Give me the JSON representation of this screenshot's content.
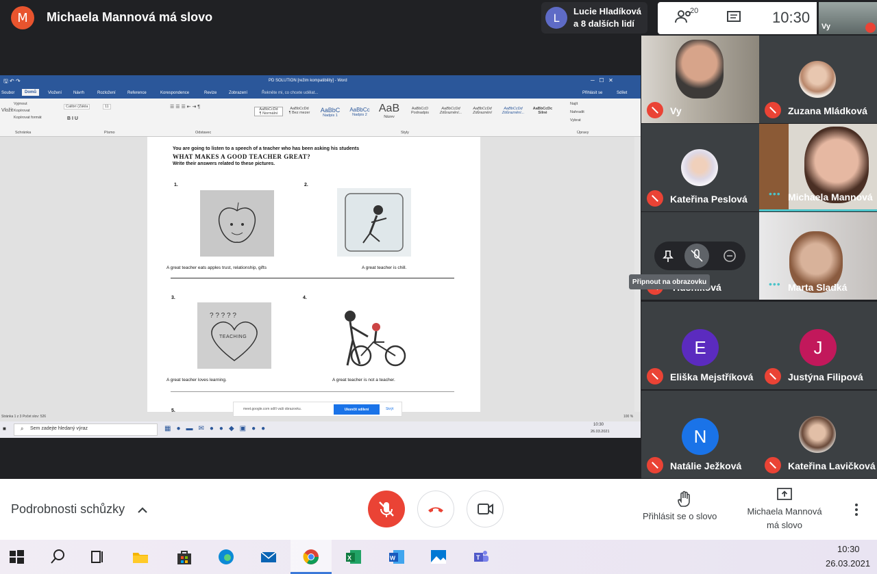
{
  "meeting": {
    "presenter_initial": "M",
    "presenter_title": "Michaela Mannová má slovo",
    "raised_hands_initial": "L",
    "raised_hands_line1": "Lucie Hladíková",
    "raised_hands_line2": "a 8 dalších lidí",
    "people_count": "20",
    "time": "10:30",
    "self_label": "Vy"
  },
  "word": {
    "window_title": "PD SOLUTION [režim kompatibility] - Word",
    "tabs": [
      "Soubor",
      "Domů",
      "Vložení",
      "Návrh",
      "Rozložení",
      "Reference",
      "Korespondence",
      "Revize",
      "Zobrazení"
    ],
    "tell_me": "Řekněte mi, co chcete udělat...",
    "sign_in": "Přihlásit se",
    "share": "Sdílet",
    "clipboard": {
      "cut": "Vyjmout",
      "copy": "Kopírovat",
      "format": "Kopírovat formát",
      "group": "Schránka",
      "paste": "Vložit"
    },
    "font_name": "Calibri (Zákla",
    "font_size": "11",
    "group_font": "Písmo",
    "group_paragraph": "Odstavec",
    "group_styles": "Styly",
    "group_edit": "Úpravy",
    "styles": [
      {
        "sample": "AaBbCcDd",
        "name": "¶ Normální"
      },
      {
        "sample": "AaBbCcDd",
        "name": "¶ Bez mezer"
      },
      {
        "sample": "AaBbC",
        "name": "Nadpis 1"
      },
      {
        "sample": "AaBbCc",
        "name": "Nadpis 2"
      },
      {
        "sample": "AaB",
        "name": "Název"
      },
      {
        "sample": "AaBbCcD",
        "name": "Podnadpis"
      },
      {
        "sample": "AaBbCcDd",
        "name": "Zdůraznění..."
      },
      {
        "sample": "AaBbCcDd",
        "name": "Zdůraznění"
      },
      {
        "sample": "AaBbCcDd",
        "name": "Zdůraznění..."
      },
      {
        "sample": "AaBbCcDc",
        "name": "Silné"
      }
    ],
    "edit": {
      "find": "Najít",
      "replace": "Nahradit",
      "select": "Vybrat"
    },
    "status_left": "Stránka 1 z 3   Počet slov: 526",
    "zoom": "100 %",
    "search_placeholder": "Sem zadejte hledaný výraz",
    "sys_time": "10:30",
    "sys_date": "26.03.2021"
  },
  "document": {
    "intro": "You are going to listen to a speech of a teacher who has been asking his students",
    "heading": "WHAT MAKES A GOOD TEACHER GREAT?",
    "instruction": "Write their answers related to these pictures.",
    "items": [
      {
        "num": "1.",
        "caption": "A great teacher eats apples    trust, relationship, gifts"
      },
      {
        "num": "2.",
        "caption": "A great teacher is chill."
      },
      {
        "num": "3.",
        "caption": "A great teacher loves learning."
      },
      {
        "num": "4.",
        "caption": "A great teacher is not a teacher."
      },
      {
        "num": "5.",
        "caption": ""
      }
    ],
    "heart_word": "TEACHING"
  },
  "share_toast": {
    "text": "meet.google.com sdílí vaši obrazovku.",
    "stop": "Ukončit sdílení",
    "hide": "Skrýt"
  },
  "participants": [
    {
      "name": "Vy",
      "initial": "",
      "color": "",
      "kind": "video"
    },
    {
      "name": "Zuzana Mládková",
      "initial": "",
      "color": "",
      "kind": "photo"
    },
    {
      "name": "Kateřina Peslová",
      "initial": "",
      "color": "",
      "kind": "photo"
    },
    {
      "name": "Michaela Mannová",
      "initial": "",
      "color": "",
      "kind": "video-speaking"
    },
    {
      "name": "Husníková",
      "initial": "",
      "color": "",
      "kind": "photo-hover"
    },
    {
      "name": "Marta Sladká",
      "initial": "",
      "color": "",
      "kind": "video-speaking"
    },
    {
      "name": "Eliška Mejstříková",
      "initial": "E",
      "color": "#5b2bbf",
      "kind": "avatar"
    },
    {
      "name": "Justýna Filipová",
      "initial": "J",
      "color": "#c2185b",
      "kind": "avatar"
    },
    {
      "name": "Natálie Ježková",
      "initial": "N",
      "color": "#1a73e8",
      "kind": "avatar"
    },
    {
      "name": "Kateřina Lavičková",
      "initial": "",
      "color": "",
      "kind": "photo"
    }
  ],
  "pin_tooltip": "Připnout na obrazovku",
  "bottom": {
    "details": "Podrobnosti schůzky",
    "raise_hand": "Přihlásit se o slovo",
    "presenting_line1": "Michaela Mannová",
    "presenting_line2": "má slovo"
  },
  "taskbar": {
    "time": "10:30",
    "date": "26.03.2021"
  },
  "colors": {
    "accent_red": "#ea4335",
    "word_blue": "#2b579a",
    "speaking": "#4bc3c9"
  }
}
